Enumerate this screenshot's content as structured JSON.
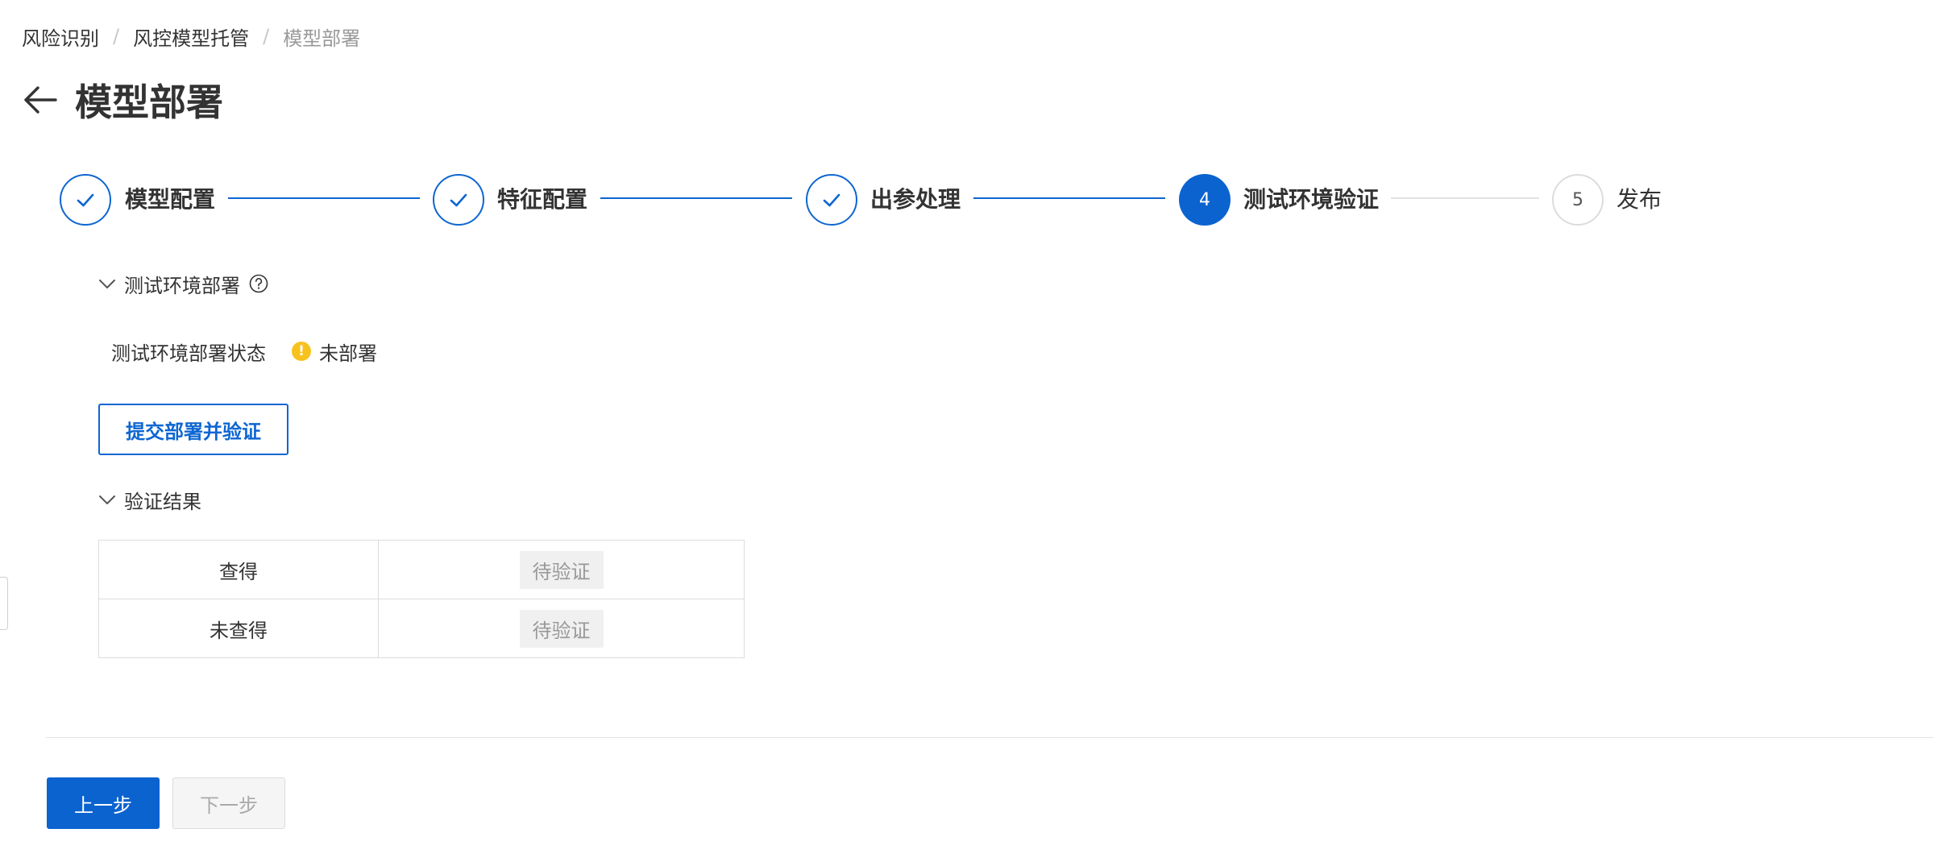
{
  "breadcrumb": {
    "items": [
      "风险识别",
      "风控模型托管",
      "模型部署"
    ],
    "separator": "/"
  },
  "header": {
    "title": "模型部署"
  },
  "steps": [
    {
      "label": "模型配置",
      "status": "done"
    },
    {
      "label": "特征配置",
      "status": "done"
    },
    {
      "label": "出参处理",
      "status": "done"
    },
    {
      "label": "测试环境验证",
      "status": "active",
      "number": "4"
    },
    {
      "label": "发布",
      "status": "wait",
      "number": "5"
    }
  ],
  "deploy_section": {
    "title": "测试环境部署",
    "status_label": "测试环境部署状态",
    "status_value": "未部署",
    "status_icon_char": "!",
    "submit_label": "提交部署并验证"
  },
  "result_section": {
    "title": "验证结果",
    "rows": [
      {
        "name": "查得",
        "value": "待验证"
      },
      {
        "name": "未查得",
        "value": "待验证"
      }
    ]
  },
  "footer": {
    "prev_label": "上一步",
    "next_label": "下一步"
  },
  "colors": {
    "primary": "#0b63d0",
    "warning": "#f7c21e",
    "border": "#dcdcdc",
    "muted": "#999999"
  },
  "icons": {
    "back": "arrow-left-icon",
    "done_step": "check-icon",
    "section_toggle": "chevron-down-icon",
    "help": "question-circle-icon",
    "status": "warning-circle-icon"
  }
}
